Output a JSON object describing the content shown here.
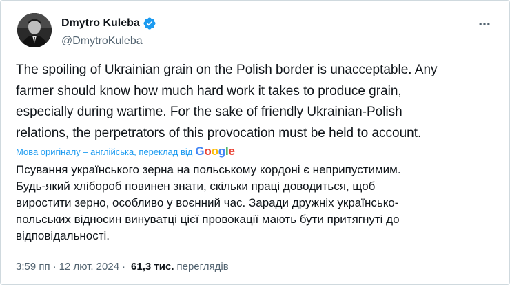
{
  "author": {
    "display_name": "Dmytro Kuleba",
    "handle": "@DmytroKuleba",
    "verified": true
  },
  "tweet": {
    "lines": [
      "The spoiling of Ukrainian grain on the Polish border is unacceptable. Any",
      "farmer should know how much hard work it takes to produce grain,",
      "especially during wartime. For the sake of friendly Ukrainian-Polish",
      "relations, the perpetrators of this provocation must be held to account."
    ]
  },
  "translation": {
    "notice": "Мова оригіналу – англійська, переклад від",
    "google_letters": [
      {
        "ch": "G",
        "color": "#4285F4"
      },
      {
        "ch": "o",
        "color": "#EA4335"
      },
      {
        "ch": "o",
        "color": "#FBBC05"
      },
      {
        "ch": "g",
        "color": "#4285F4"
      },
      {
        "ch": "l",
        "color": "#34A853"
      },
      {
        "ch": "e",
        "color": "#EA4335"
      }
    ],
    "lines": [
      "Псування українського зерна на польському кордоні є неприпустимим.",
      "Будь-який хлібороб повинен знати, скільки праці доводиться, щоб",
      "виростити зерно, особливо у воєнний час. Заради дружніх українсько-",
      "польських відносин винуватці цієї провокації мають бути притягнуті до",
      "відповідальності."
    ]
  },
  "meta": {
    "time": "3:59 пп",
    "date": "12 лют. 2024",
    "separator": "·",
    "views_count": "61,3 тис.",
    "views_label": "переглядів"
  },
  "colors": {
    "link": "#1d9bf0",
    "verified": "#1d9bf0",
    "secondary": "#536471",
    "primary": "#0f1419"
  },
  "icons": {
    "verified": "verified-badge-icon",
    "more": "more-horizontal-icon"
  }
}
